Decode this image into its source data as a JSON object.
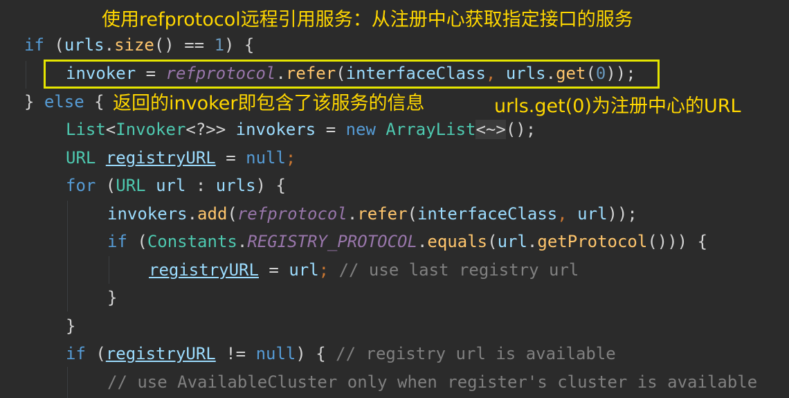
{
  "annotations": {
    "top": "使用refprotocol远程引用服务：从注册中心获取指定接口的服务",
    "invoker_note": "返回的invoker即包含了该服务的信息",
    "url_note": "urls.get(0)为注册中心的URL"
  },
  "code": {
    "l1": [
      "if",
      " (",
      "urls",
      ".",
      "size",
      "() == ",
      "1",
      ") {"
    ],
    "l2": [
      "invoker",
      " = ",
      "refprotocol",
      ".",
      "refer",
      "(",
      "interfaceClass",
      ", ",
      "urls",
      ".",
      "get",
      "(",
      "0",
      "));"
    ],
    "l3": [
      "} ",
      "else",
      " {"
    ],
    "l4": [
      "List",
      "<",
      "Invoker",
      "<?>> ",
      "invokers",
      " = ",
      "new",
      " ",
      "ArrayList",
      "<~>",
      "();"
    ],
    "l5": [
      "URL",
      " ",
      "registryURL",
      " = ",
      "null",
      ";"
    ],
    "l6": [
      "for",
      " (",
      "URL",
      " ",
      "url",
      " : ",
      "urls",
      ") {"
    ],
    "l7": [
      "invokers",
      ".",
      "add",
      "(",
      "refprotocol",
      ".",
      "refer",
      "(",
      "interfaceClass",
      ", ",
      "url",
      "));"
    ],
    "l8": [
      "if",
      " (",
      "Constants",
      ".",
      "REGISTRY_PROTOCOL",
      ".",
      "equals",
      "(",
      "url",
      ".",
      "getProtocol",
      "())) {"
    ],
    "l9": [
      "registryURL",
      " = ",
      "url",
      "; ",
      "// use last registry url"
    ],
    "l10": [
      "}"
    ],
    "l11": [
      "}"
    ],
    "l12": [
      "if",
      " (",
      "registryURL",
      " != ",
      "null",
      ") { ",
      "// registry url is available"
    ],
    "l13": [
      "// use AvailableCluster only when register's cluster is available"
    ]
  },
  "colors": {
    "background": "#2b2b2b",
    "annotation_text": "#ffd700",
    "highlight_box": "#e5e500"
  }
}
